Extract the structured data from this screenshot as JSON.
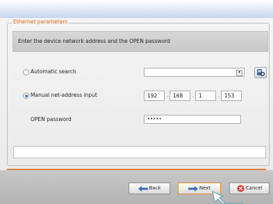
{
  "group": {
    "legend": "Ethernet parameters"
  },
  "instruction": "Enter the device network address and the OPEN password",
  "automatic": {
    "label": "Automatic search",
    "selected": false,
    "dropdown_value": ""
  },
  "manual": {
    "label": "Manual net-address input",
    "selected": true,
    "ip": [
      "192",
      "168",
      "1",
      "153"
    ]
  },
  "password": {
    "label": "OPEN password",
    "value": "•••••"
  },
  "status_text": "",
  "buttons": {
    "back": "Back",
    "next": "Next",
    "cancel": "Cancel"
  },
  "icons": {
    "search": "search-device-icon",
    "back": "arrow-left-icon",
    "next": "arrow-right-icon",
    "cancel": "close-circle-icon",
    "cursor": "mouse-pointer-icon"
  },
  "colors": {
    "accent": "#e07b39",
    "radio_selected": "#3a7bd0",
    "cancel_red": "#d23a2a"
  }
}
